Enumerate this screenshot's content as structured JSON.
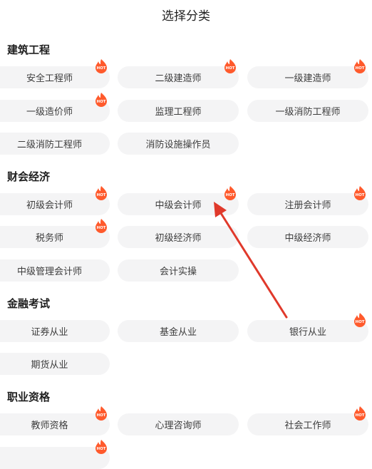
{
  "header": {
    "title": "选择分类"
  },
  "hot_label": "HOT",
  "colors": {
    "hot": "#ff5a2c",
    "arrow": "#e0392b",
    "pill_bg": "#f4f4f5"
  },
  "sections": [
    {
      "title": "建筑工程",
      "items": [
        "安全工程师",
        "二级建造师",
        "一级建造师",
        "一级造价师",
        "监理工程师",
        "一级消防工程师",
        "二级消防工程师",
        "消防设施操作员"
      ]
    },
    {
      "title": "财会经济",
      "items": [
        "初级会计师",
        "中级会计师",
        "注册会计师",
        "税务师",
        "初级经济师",
        "中级经济师",
        "中级管理会计师",
        "会计实操"
      ]
    },
    {
      "title": "金融考试",
      "items": [
        "证券从业",
        "基金从业",
        "银行从业",
        "期货从业"
      ]
    },
    {
      "title": "职业资格",
      "items": [
        "教师资格",
        "心理咨询师",
        "社会工作师"
      ]
    }
  ]
}
